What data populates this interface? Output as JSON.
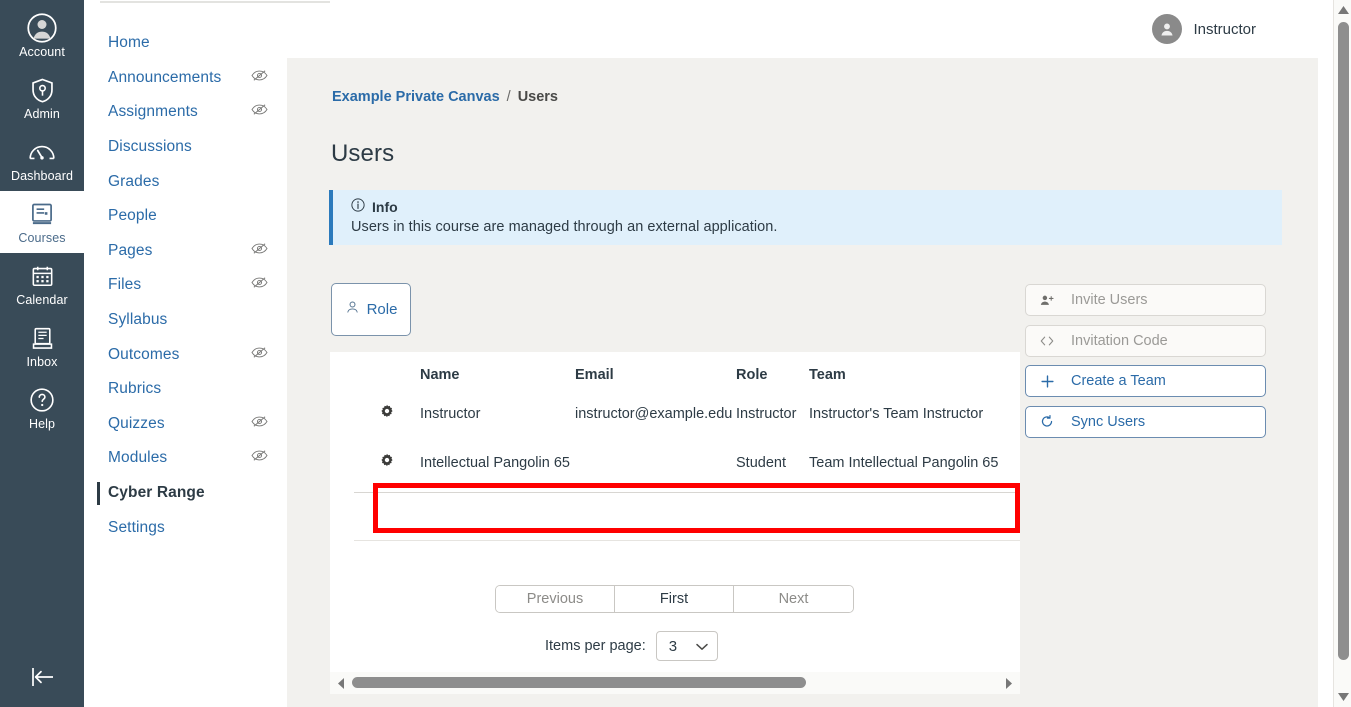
{
  "global_nav": {
    "items": [
      {
        "label": "Account",
        "icon": "account-avatar-icon",
        "active": false
      },
      {
        "label": "Admin",
        "icon": "shield-key-icon",
        "active": false
      },
      {
        "label": "Dashboard",
        "icon": "dashboard-gauge-icon",
        "active": false
      },
      {
        "label": "Courses",
        "icon": "courses-book-icon",
        "active": true
      },
      {
        "label": "Calendar",
        "icon": "calendar-icon",
        "active": false
      },
      {
        "label": "Inbox",
        "icon": "inbox-tray-icon",
        "active": false
      },
      {
        "label": "Help",
        "icon": "help-question-icon",
        "active": false
      }
    ],
    "collapse_icon": "collapse-left-arrow-icon"
  },
  "course_nav": {
    "items": [
      {
        "label": "Home",
        "hidden_icon": false,
        "active": false
      },
      {
        "label": "Announcements",
        "hidden_icon": true,
        "active": false
      },
      {
        "label": "Assignments",
        "hidden_icon": true,
        "active": false
      },
      {
        "label": "Discussions",
        "hidden_icon": false,
        "active": false
      },
      {
        "label": "Grades",
        "hidden_icon": false,
        "active": false
      },
      {
        "label": "People",
        "hidden_icon": false,
        "active": false
      },
      {
        "label": "Pages",
        "hidden_icon": true,
        "active": false
      },
      {
        "label": "Files",
        "hidden_icon": true,
        "active": false
      },
      {
        "label": "Syllabus",
        "hidden_icon": false,
        "active": false
      },
      {
        "label": "Outcomes",
        "hidden_icon": true,
        "active": false
      },
      {
        "label": "Rubrics",
        "hidden_icon": false,
        "active": false
      },
      {
        "label": "Quizzes",
        "hidden_icon": true,
        "active": false
      },
      {
        "label": "Modules",
        "hidden_icon": true,
        "active": false
      },
      {
        "label": "Cyber Range",
        "hidden_icon": false,
        "active": true
      },
      {
        "label": "Settings",
        "hidden_icon": false,
        "active": false
      }
    ]
  },
  "top_bar": {
    "user_name": "Instructor",
    "avatar_icon": "user-avatar-icon"
  },
  "breadcrumb": {
    "course": "Example Private Canvas",
    "separator": "/",
    "current": "Users"
  },
  "page_title": "Users",
  "info_alert": {
    "icon": "info-circle-icon",
    "heading": "Info",
    "message": "Users in this course are managed through an external application."
  },
  "role_filter": {
    "label": "Role",
    "icon": "person-outline-icon"
  },
  "actions": [
    {
      "label": "Invite Users",
      "icon": "person-add-icon",
      "icon_glyph": "\u0000",
      "state": "disabled"
    },
    {
      "label": "Invitation Code",
      "icon": "code-brackets-icon",
      "icon_glyph": "<>",
      "state": "disabled"
    },
    {
      "label": "Create a Team",
      "icon": "plus-icon",
      "icon_glyph": "+",
      "state": "enabled"
    },
    {
      "label": "Sync Users",
      "icon": "refresh-sync-icon",
      "icon_glyph": "⟳",
      "state": "enabled"
    }
  ],
  "users_table": {
    "columns": [
      "",
      "Name",
      "Email",
      "Role",
      "Team"
    ],
    "rows": [
      {
        "gear_icon": "gear-icon",
        "name": "Instructor",
        "email": "instructor@example.edu",
        "role": "Instructor",
        "team": "Instructor's Team Instructor",
        "highlighted": false
      },
      {
        "gear_icon": "gear-icon",
        "name": "Intellectual Pangolin 65",
        "email": "",
        "role": "Student",
        "team": "Team Intellectual Pangolin 65",
        "highlighted": true
      }
    ]
  },
  "pagination": {
    "previous": "Previous",
    "first": "First",
    "next": "Next",
    "items_per_page_label": "Items per page:",
    "items_per_page_value": "3",
    "chevron_icon": "chevron-down-icon"
  },
  "scrollbars": {
    "horizontal_left_icon": "triangle-left-icon",
    "horizontal_right_icon": "triangle-right-icon",
    "vertical_up_icon": "triangle-up-icon",
    "vertical_down_icon": "triangle-down-icon"
  },
  "colors": {
    "global_nav_bg": "#394B58",
    "link_blue": "#2B6BA8",
    "content_bg": "#F2F1EE",
    "info_bg": "#E0F0FB",
    "info_border": "#2B7ABC",
    "highlight_red": "#FF0000",
    "text_dark": "#2D3B45"
  }
}
